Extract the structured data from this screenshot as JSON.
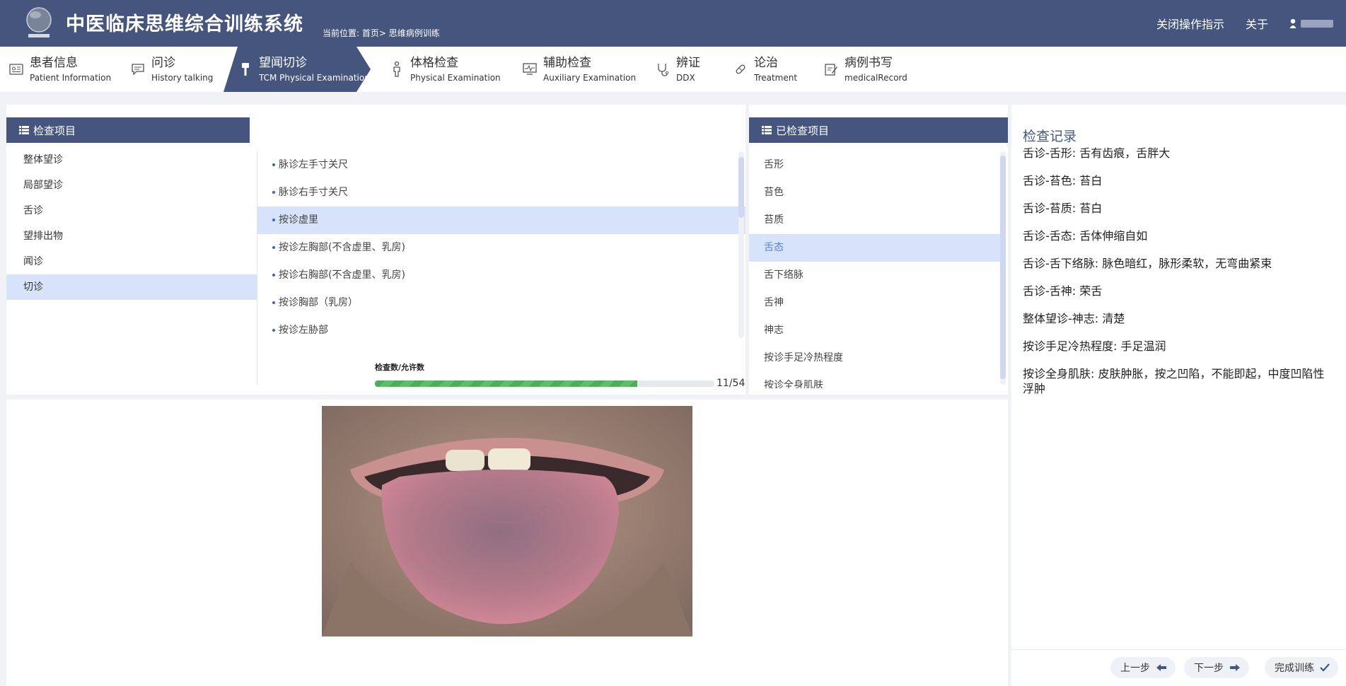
{
  "header": {
    "title": "中医临床思维综合训练系统",
    "breadcrumb": "当前位置: 首页> 思维病例训练",
    "close_guide": "关闭操作指示",
    "about": "关于"
  },
  "steps": [
    {
      "cn": "患者信息",
      "en": "Patient Information",
      "icon": "id-card-icon"
    },
    {
      "cn": "问诊",
      "en": "History talking",
      "icon": "chat-icon"
    },
    {
      "cn": "望闻切诊",
      "en": "TCM Physical Examination",
      "icon": "pulse-icon"
    },
    {
      "cn": "体格检查",
      "en": "Physical Examination",
      "icon": "person-icon"
    },
    {
      "cn": "辅助检查",
      "en": "Auxiliary Examination",
      "icon": "monitor-icon"
    },
    {
      "cn": "辨证",
      "en": "DDX",
      "icon": "stethoscope-icon"
    },
    {
      "cn": "论治",
      "en": "Treatment",
      "icon": "pill-icon"
    },
    {
      "cn": "病例书写",
      "en": "medicalRecord",
      "icon": "edit-icon"
    }
  ],
  "exam": {
    "header": "检查项目",
    "categories": [
      "整体望诊",
      "局部望诊",
      "舌诊",
      "望排出物",
      "闻诊",
      "切诊"
    ],
    "items": [
      "脉诊左手寸关尺",
      "脉诊右手寸关尺",
      "按诊虚里",
      "按诊左胸部(不含虚里、乳房)",
      "按诊右胸部(不含虚里、乳房)",
      "按诊胸部（乳房）",
      "按诊左胁部"
    ],
    "progress_label": "检查数/允许数",
    "progress_count": "11/54",
    "progress_fraction": 0.772
  },
  "done": {
    "header": "已检查项目",
    "items": [
      "舌形",
      "苔色",
      "苔质",
      "舌态",
      "舌下络脉",
      "舌神",
      "神志",
      "按诊手足冷热程度",
      "按诊全身肌肤"
    ]
  },
  "record": {
    "title": "检查记录",
    "rows": [
      "舌诊-舌形: 舌有齿痕，舌胖大",
      "舌诊-苔色: 苔白",
      "舌诊-苔质: 苔白",
      "舌诊-舌态: 舌体伸缩自如",
      "舌诊-舌下络脉: 脉色暗红，脉形柔软，无弯曲紧束",
      "舌诊-舌神: 荣舌",
      "整体望诊-神志: 清楚",
      "按诊手足冷热程度: 手足温润",
      "按诊全身肌肤: 皮肤肿胀，按之凹陷，不能即起，中度凹陷性浮肿"
    ]
  },
  "footer": {
    "prev": "上一步",
    "next": "下一步",
    "finish": "完成训练"
  },
  "colors": {
    "header_bg": "#45557e",
    "selected_bg": "#d7e3fb",
    "progress": "#4cae5a"
  }
}
